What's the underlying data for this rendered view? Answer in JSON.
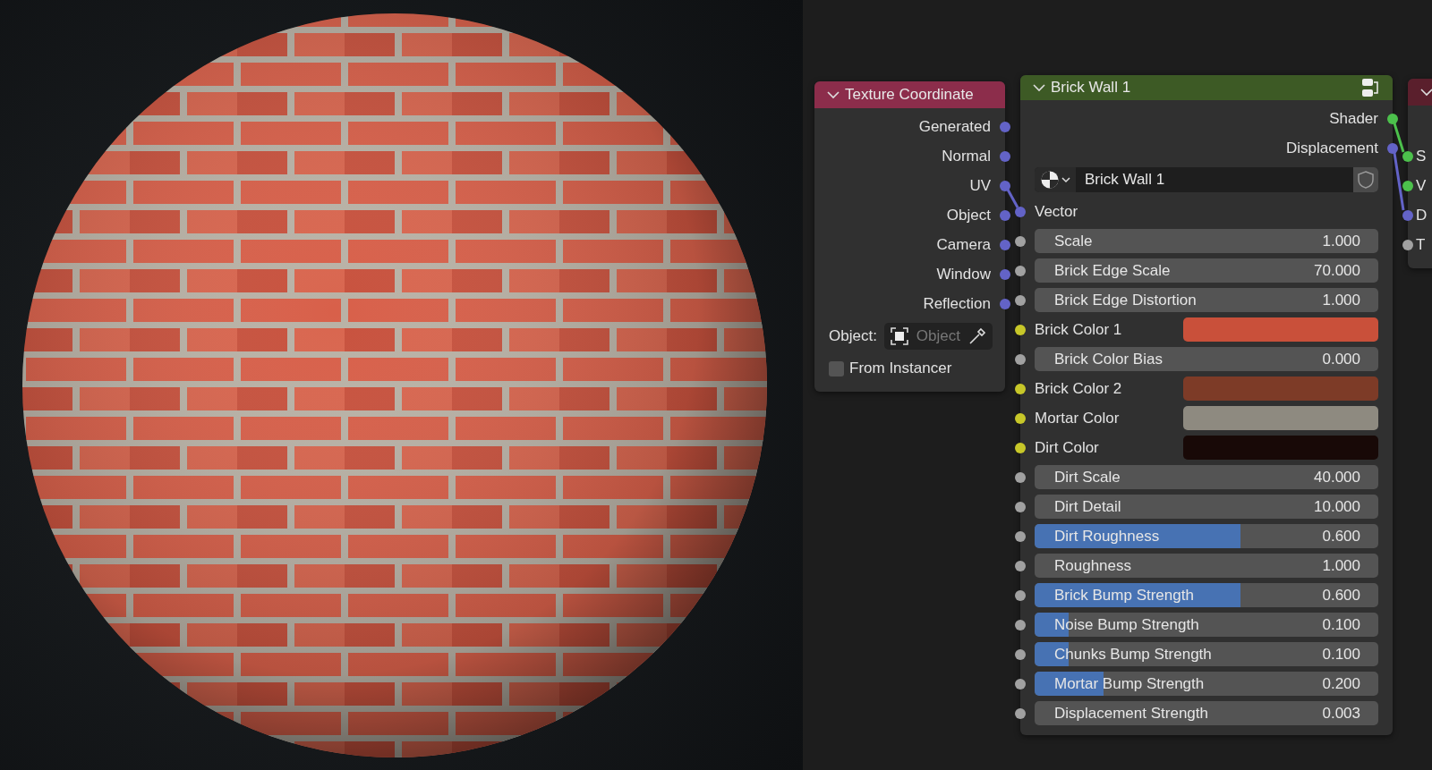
{
  "texture_coordinate_node": {
    "title": "Texture Coordinate",
    "outputs": [
      {
        "label": "Generated",
        "kind": "vector"
      },
      {
        "label": "Normal",
        "kind": "vector"
      },
      {
        "label": "UV",
        "kind": "vector"
      },
      {
        "label": "Object",
        "kind": "vector"
      },
      {
        "label": "Camera",
        "kind": "vector"
      },
      {
        "label": "Window",
        "kind": "vector"
      },
      {
        "label": "Reflection",
        "kind": "vector"
      }
    ],
    "object_field": {
      "label": "Object:",
      "placeholder": "Object"
    },
    "from_instancer": {
      "label": "From Instancer",
      "checked": false
    }
  },
  "brick_wall_node": {
    "title": "Brick Wall 1",
    "outputs": [
      {
        "label": "Shader",
        "kind": "shader"
      },
      {
        "label": "Displacement",
        "kind": "vector"
      }
    ],
    "datablock": {
      "value": "Brick Wall 1"
    },
    "inputs": [
      {
        "kind": "vector",
        "label": "Vector"
      },
      {
        "kind": "number",
        "label": "Scale",
        "value": "1.000"
      },
      {
        "kind": "number",
        "label": "Brick Edge Scale",
        "value": "70.000"
      },
      {
        "kind": "number",
        "label": "Brick Edge Distortion",
        "value": "1.000"
      },
      {
        "kind": "color",
        "label": "Brick Color 1",
        "color": "#c9503a"
      },
      {
        "kind": "number",
        "label": "Brick Color Bias",
        "value": "0.000"
      },
      {
        "kind": "color",
        "label": "Brick Color 2",
        "color": "#7d3b27"
      },
      {
        "kind": "color",
        "label": "Mortar Color",
        "color": "#8e8a80"
      },
      {
        "kind": "color",
        "label": "Dirt Color",
        "color": "#180907"
      },
      {
        "kind": "number",
        "label": "Dirt Scale",
        "value": "40.000"
      },
      {
        "kind": "number",
        "label": "Dirt Detail",
        "value": "10.000"
      },
      {
        "kind": "slider",
        "label": "Dirt Roughness",
        "value": "0.600",
        "level": 0.6
      },
      {
        "kind": "number",
        "label": "Roughness",
        "value": "1.000"
      },
      {
        "kind": "slider",
        "label": "Brick Bump Strength",
        "value": "0.600",
        "level": 0.6
      },
      {
        "kind": "slider",
        "label": "Noise Bump Strength",
        "value": "0.100",
        "level": 0.1
      },
      {
        "kind": "slider",
        "label": "Chunks Bump Strength",
        "value": "0.100",
        "level": 0.1
      },
      {
        "kind": "slider",
        "label": "Mortar Bump Strength",
        "value": "0.200",
        "level": 0.2
      },
      {
        "kind": "number",
        "label": "Displacement Strength",
        "value": "0.003"
      }
    ]
  },
  "third_node": {
    "inputs": [
      {
        "label": "S",
        "kind": "shader"
      },
      {
        "label": "V",
        "kind": "shader"
      },
      {
        "label": "D",
        "kind": "vector"
      },
      {
        "label": "T",
        "kind": "value"
      }
    ]
  }
}
